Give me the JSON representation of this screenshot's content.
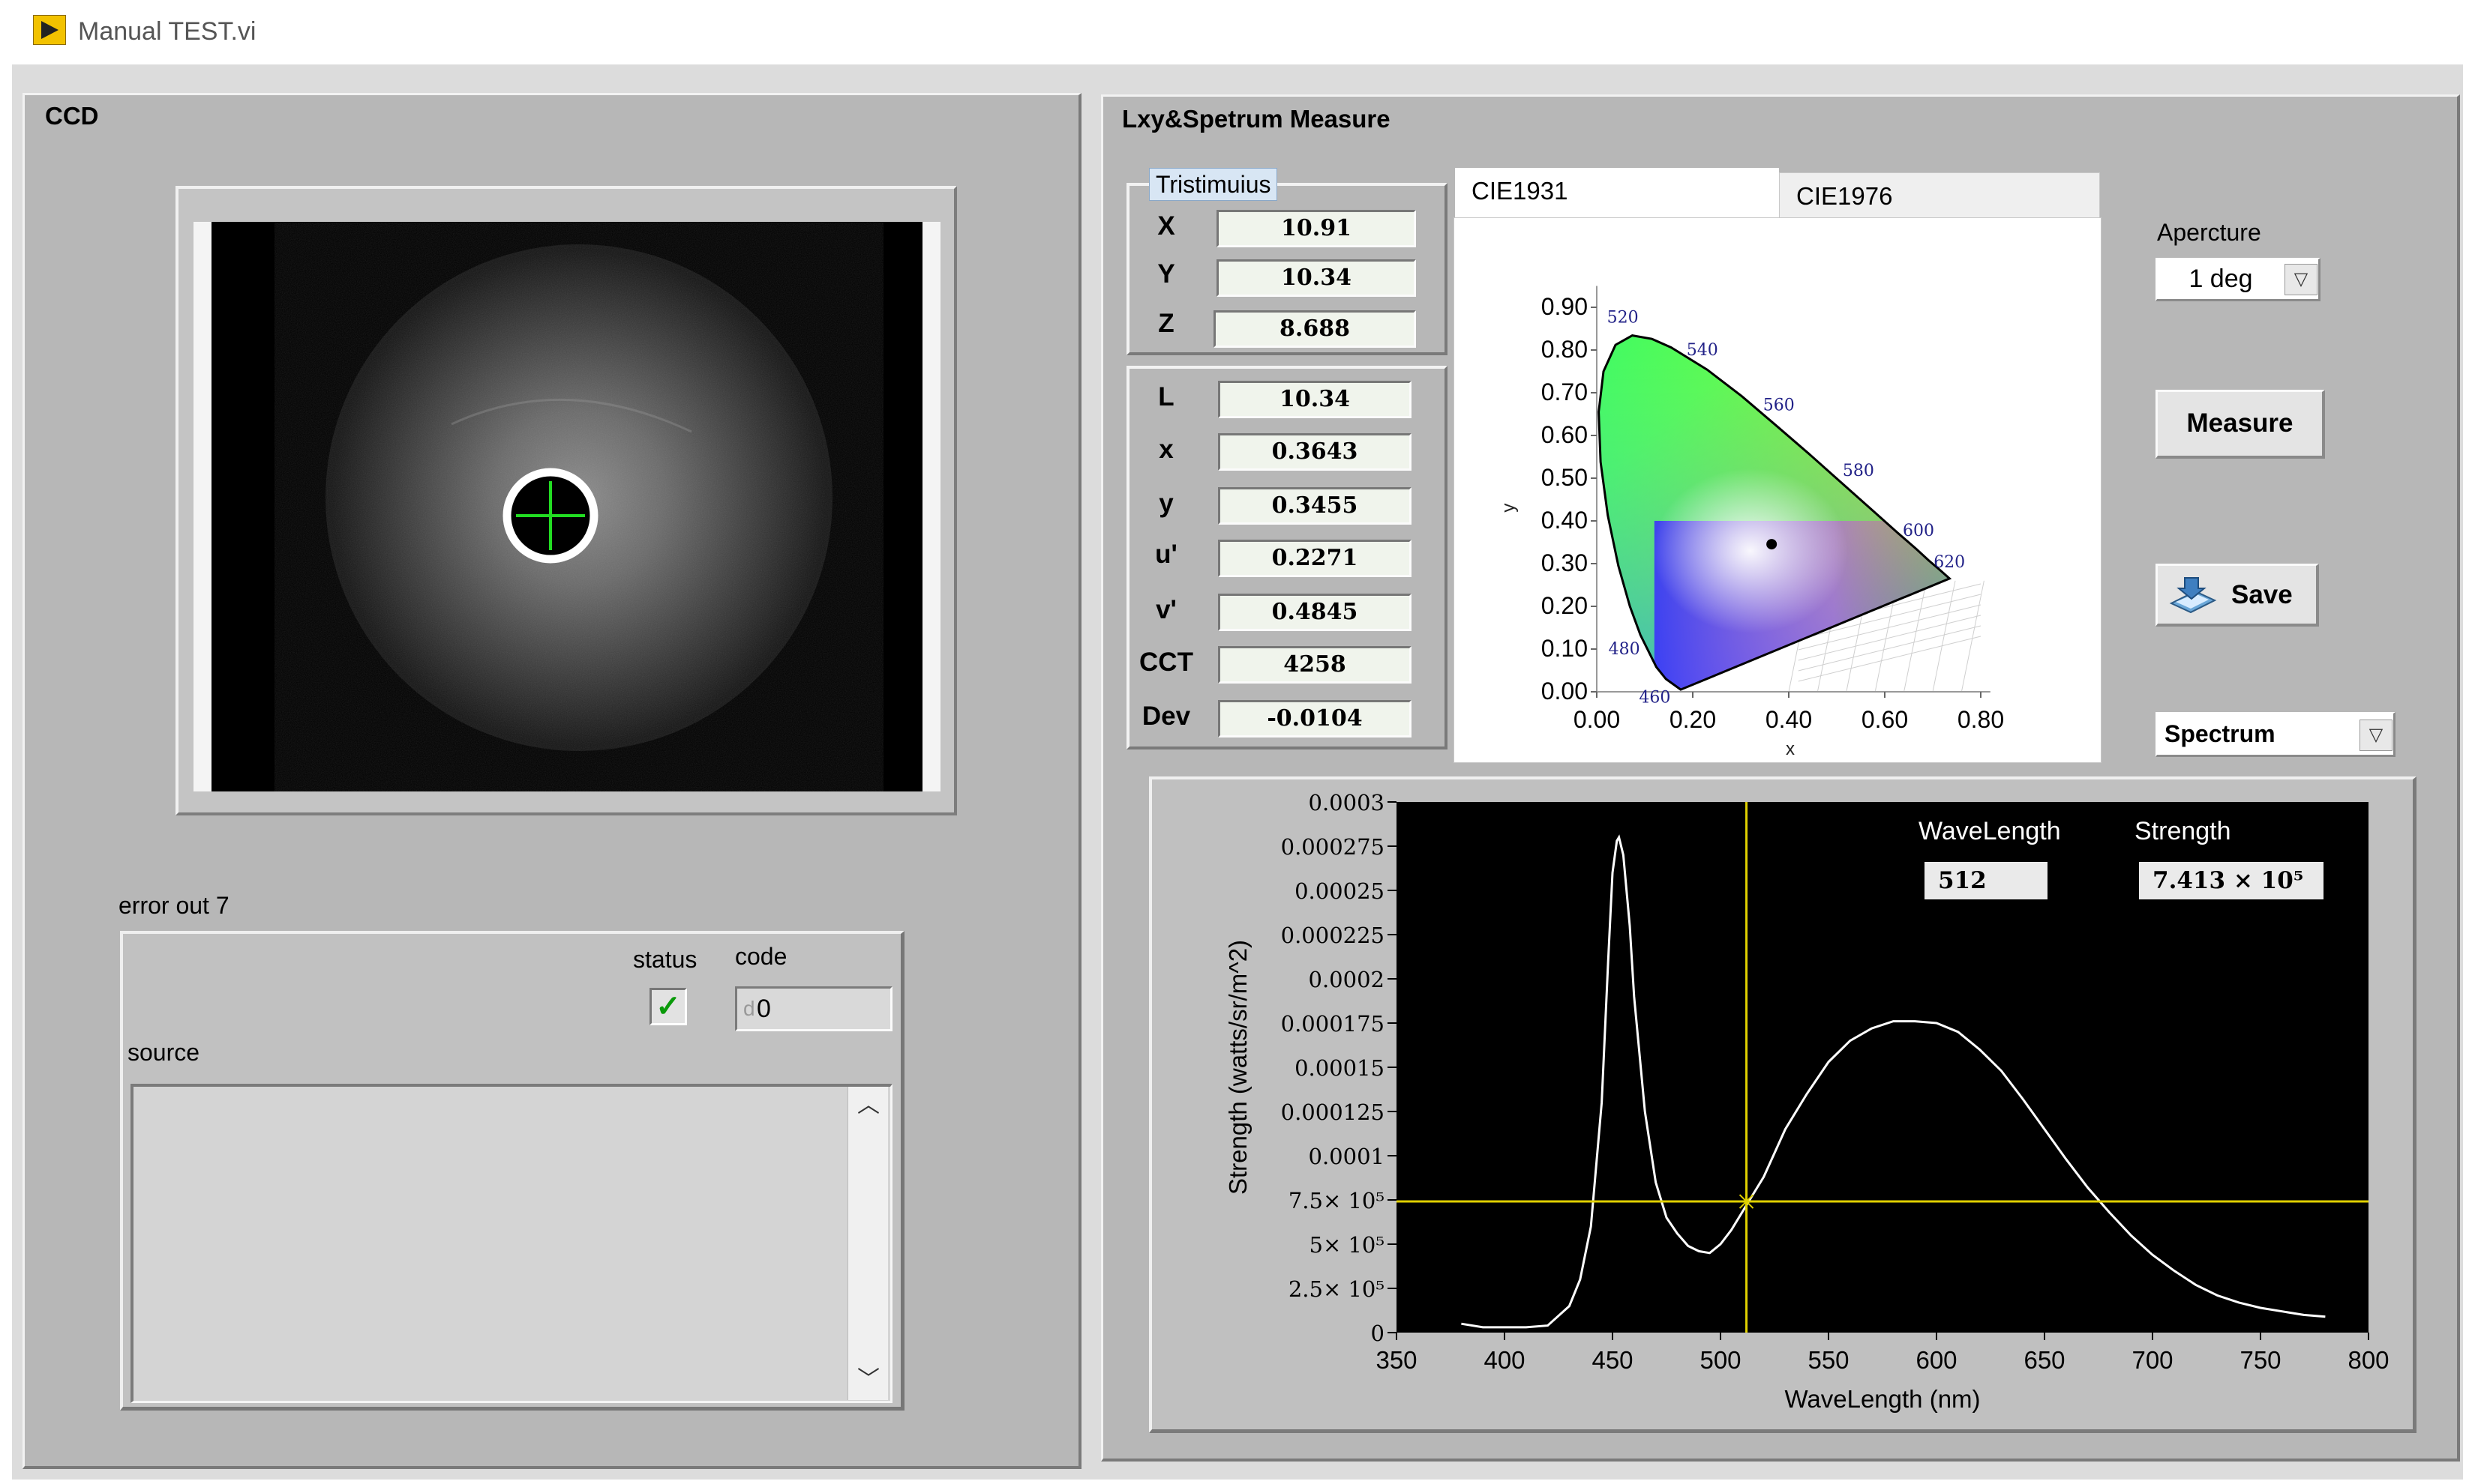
{
  "window": {
    "title": "Manual TEST.vi"
  },
  "ccd": {
    "title": "CCD"
  },
  "error_cluster": {
    "label": "error out 7",
    "status_label": "status",
    "status_mark": "✓",
    "code_label": "code",
    "code_radix": "d",
    "code_value": "0",
    "source_label": "source",
    "source_value": ""
  },
  "measure_panel": {
    "title": "Lxy&Spetrum Measure",
    "tristimulus": {
      "title": "Tristimuius",
      "rows": [
        {
          "label": "X",
          "value": "10.91"
        },
        {
          "label": "Y",
          "value": "10.34"
        },
        {
          "label": "Z",
          "value": "8.688"
        }
      ]
    },
    "chromaticity": {
      "rows": [
        {
          "label": "L",
          "value": "10.34"
        },
        {
          "label": "x",
          "value": "0.3643"
        },
        {
          "label": "y",
          "value": "0.3455"
        },
        {
          "label": "u'",
          "value": "0.2271"
        },
        {
          "label": "v'",
          "value": "0.4845"
        },
        {
          "label": "CCT",
          "value": "4258"
        },
        {
          "label": "Dev",
          "value": "-0.0104"
        }
      ]
    },
    "tabs": [
      {
        "label": "CIE1931",
        "active": true
      },
      {
        "label": "CIE1976",
        "active": false
      }
    ],
    "aperture": {
      "label": "Apercture",
      "value": "1 deg"
    },
    "measure_button": "Measure",
    "save_button": "Save",
    "view_select": "Spectrum"
  },
  "cie_plot": {
    "x_ticks": [
      "0.00",
      "0.20",
      "0.40",
      "0.60",
      "0.80"
    ],
    "y_ticks": [
      "0.00",
      "0.10",
      "0.20",
      "0.30",
      "0.40",
      "0.50",
      "0.60",
      "0.70",
      "0.80",
      "0.90"
    ],
    "xlabel": "x",
    "ylabel": "y",
    "locus_labels": [
      {
        "nm": "460",
        "x": 0.144,
        "y": 0.03
      },
      {
        "nm": "480",
        "x": 0.091,
        "y": 0.133
      },
      {
        "nm": "520",
        "x": 0.074,
        "y": 0.834
      },
      {
        "nm": "540",
        "x": 0.23,
        "y": 0.754
      },
      {
        "nm": "560",
        "x": 0.373,
        "y": 0.624
      },
      {
        "nm": "580",
        "x": 0.512,
        "y": 0.487
      },
      {
        "nm": "600",
        "x": 0.627,
        "y": 0.372
      },
      {
        "nm": "620",
        "x": 0.691,
        "y": 0.308
      }
    ],
    "measured_point": {
      "x": 0.3643,
      "y": 0.3455
    }
  },
  "chart_data": {
    "type": "line",
    "xlabel": "WaveLength  (nm)",
    "ylabel": "Strength  (watts/sr/m^2)",
    "xlim": [
      350,
      800
    ],
    "ylim": [
      0,
      0.0003
    ],
    "x_ticks": [
      "350",
      "400",
      "450",
      "500",
      "550",
      "600",
      "650",
      "700",
      "750",
      "800"
    ],
    "y_ticks": [
      {
        "value": 0,
        "label": "0"
      },
      {
        "value": 2.5e-05,
        "label": "2.5× 10⁵"
      },
      {
        "value": 5e-05,
        "label": "5× 10⁵"
      },
      {
        "value": 7.5e-05,
        "label": "7.5× 10⁵"
      },
      {
        "value": 0.0001,
        "label": "0.0001"
      },
      {
        "value": 0.000125,
        "label": "0.000125"
      },
      {
        "value": 0.00015,
        "label": "0.00015"
      },
      {
        "value": 0.000175,
        "label": "0.000175"
      },
      {
        "value": 0.0002,
        "label": "0.0002"
      },
      {
        "value": 0.000225,
        "label": "0.000225"
      },
      {
        "value": 0.00025,
        "label": "0.00025"
      },
      {
        "value": 0.000275,
        "label": "0.000275"
      },
      {
        "value": 0.0003,
        "label": "0.0003"
      }
    ],
    "x": [
      380,
      390,
      400,
      410,
      420,
      430,
      435,
      440,
      445,
      448,
      450,
      452,
      453,
      455,
      458,
      460,
      465,
      470,
      475,
      480,
      485,
      490,
      495,
      500,
      505,
      510,
      515,
      520,
      530,
      540,
      550,
      560,
      570,
      580,
      590,
      600,
      610,
      620,
      630,
      640,
      650,
      660,
      670,
      680,
      690,
      700,
      710,
      720,
      730,
      740,
      750,
      760,
      770,
      780
    ],
    "series": [
      {
        "values": [
          5e-06,
          3e-06,
          3e-06,
          3e-06,
          4e-06,
          1.5e-05,
          3e-05,
          6e-05,
          0.00013,
          0.00021,
          0.00026,
          0.000278,
          0.00028,
          0.00027,
          0.00023,
          0.00019,
          0.000125,
          8.5e-05,
          6.5e-05,
          5.6e-05,
          4.9e-05,
          4.6e-05,
          4.5e-05,
          5e-05,
          5.8e-05,
          6.8e-05,
          7.8e-05,
          8.8e-05,
          0.000115,
          0.000135,
          0.000153,
          0.000165,
          0.000172,
          0.000176,
          0.000176,
          0.000175,
          0.00017,
          0.00016,
          0.000148,
          0.000132,
          0.000115,
          9.8e-05,
          8.2e-05,
          6.8e-05,
          5.5e-05,
          4.4e-05,
          3.5e-05,
          2.7e-05,
          2.1e-05,
          1.7e-05,
          1.4e-05,
          1.2e-05,
          1e-05,
          9e-06
        ]
      }
    ],
    "cursor": {
      "wavelength_label": "WaveLength",
      "strength_label": "Strength",
      "wavelength_value": "512",
      "strength_value": "7.413 × 10⁵",
      "x": 512,
      "y": 7.413e-05
    },
    "background_color": "#000000",
    "line_color": "#ffffff",
    "cursor_color": "#e0d000"
  },
  "colors": {
    "panel_bg": "#b7b7b7",
    "window_bg": "#dcdcdc",
    "status_ok": "#0a9a0a",
    "crosshair": "#22dd22"
  },
  "icons": {
    "vi_icon": "labview-run-icon",
    "save_icon": "save-disk-icon",
    "dropdown_icon": "chevron-down-icon"
  }
}
